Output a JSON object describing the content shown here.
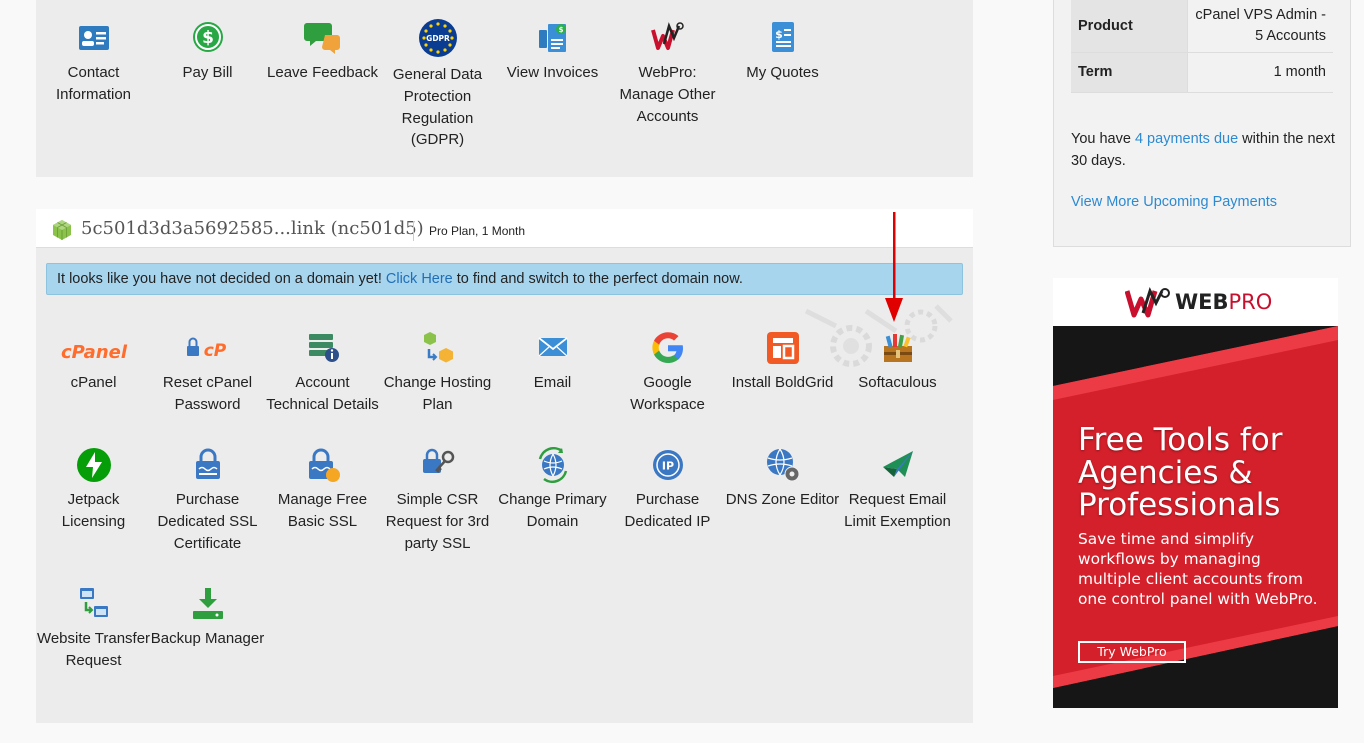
{
  "account_tiles": [
    {
      "icon": "contact-card-icon",
      "label": "Contact Information"
    },
    {
      "icon": "dollar-coin-icon",
      "label": "Pay Bill"
    },
    {
      "icon": "chat-bubbles-icon",
      "label": "Leave Feedback"
    },
    {
      "icon": "gdpr-stars-icon",
      "label": "General Data Protection Regulation (GDPR)",
      "badge": "GDPR"
    },
    {
      "icon": "invoice-documents-icon",
      "label": "View Invoices"
    },
    {
      "icon": "webpro-logo-icon",
      "label": "WebPro: Manage Other Accounts"
    },
    {
      "icon": "quote-document-icon",
      "label": "My Quotes"
    }
  ],
  "hosting": {
    "name": "5c501d3d3a5692585...link (nc501d5)",
    "plan": "Pro Plan, 1 Month",
    "notice": {
      "before": "It looks like you have not decided on a domain yet! ",
      "link": "Click Here",
      "after": " to find and switch to the perfect domain now."
    },
    "tiles": [
      {
        "icon": "cpanel-logo-icon",
        "label": "cPanel",
        "logo_text": "cPanel"
      },
      {
        "icon": "lock-cpanel-icon",
        "label": "Reset cPanel Password",
        "logo_text": "cP"
      },
      {
        "icon": "server-info-icon",
        "label": "Account Technical Details"
      },
      {
        "icon": "change-plan-cubes-icon",
        "label": "Change Hosting Plan"
      },
      {
        "icon": "envelope-icon",
        "label": "Email"
      },
      {
        "icon": "google-logo-icon",
        "label": "Google Workspace"
      },
      {
        "icon": "boldgrid-logo-icon",
        "label": "Install BoldGrid"
      },
      {
        "icon": "softaculous-box-icon",
        "label": "Softaculous"
      },
      {
        "icon": "jetpack-bolt-icon",
        "label": "Jetpack Licensing"
      },
      {
        "icon": "ssl-certificate-icon",
        "label": "Purchase Dedicated SSL Certificate"
      },
      {
        "icon": "free-ssl-lock-icon",
        "label": "Manage Free Basic SSL"
      },
      {
        "icon": "csr-key-icon",
        "label": "Simple CSR Request for 3rd party SSL"
      },
      {
        "icon": "globe-arrows-icon",
        "label": "Change Primary Domain"
      },
      {
        "icon": "ip-globe-icon",
        "label": "Purchase Dedicated IP",
        "badge": "IP"
      },
      {
        "icon": "dns-globe-gear-icon",
        "label": "DNS Zone Editor"
      },
      {
        "icon": "paper-plane-icon",
        "label": "Request Email Limit Exemption"
      },
      {
        "icon": "website-transfer-icon",
        "label": "Website Transfer Request"
      },
      {
        "icon": "backup-download-icon",
        "label": "Backup Manager"
      }
    ]
  },
  "sidebar": {
    "product_label": "Product",
    "product_value": "cPanel VPS Admin - 5 Accounts",
    "term_label": "Term",
    "term_value": "1 month",
    "payments_before": "You have ",
    "payments_link": "4 payments due",
    "payments_after": " within the next 30 days.",
    "more_link": "View More Upcoming Payments"
  },
  "ad": {
    "logo_w": "WEB",
    "logo_p": "PRO",
    "headline_1": "Free Tools for",
    "headline_2": "Agencies &",
    "headline_3": "Professionals",
    "body": "Save time and simplify workflows by managing multiple client accounts from one control panel with WebPro.",
    "button": "Try WebPro"
  },
  "colors": {
    "panel_bg": "#ececec",
    "notice_bg": "#a8d5ee",
    "link": "#2d8ad1",
    "arrow": "#e00000",
    "ad_red": "#d3202b"
  }
}
